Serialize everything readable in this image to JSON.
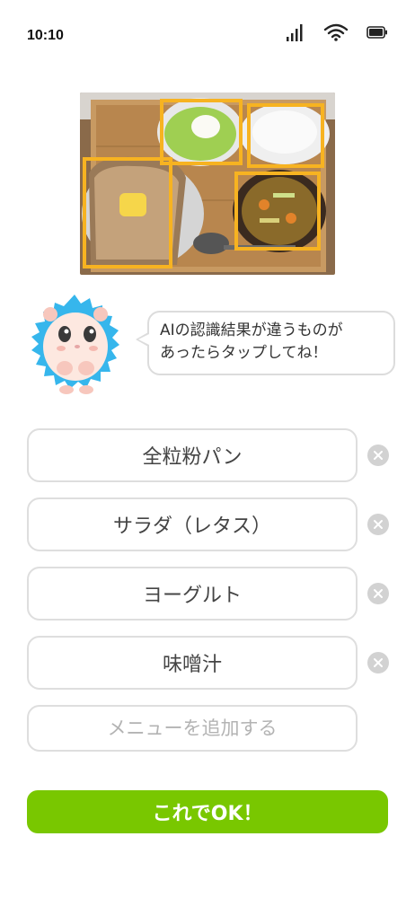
{
  "status_bar": {
    "time": "10:10",
    "icons": [
      "cellular-signal-icon",
      "wifi-icon",
      "battery-icon"
    ]
  },
  "photo": {
    "description_icon": "food-photo",
    "detected_box_color": "#f7b321",
    "detected_items_count": 4
  },
  "mascot": {
    "icon": "hedgehog-mascot",
    "bubble_line1": "AIの認識結果が違うものが",
    "bubble_line2": "あったらタップしてね！"
  },
  "food_items": [
    {
      "label": "全粒粉パン"
    },
    {
      "label": "サラダ（レタス）"
    },
    {
      "label": "ヨーグルト"
    },
    {
      "label": "味噌汁"
    }
  ],
  "add_menu": {
    "placeholder": "メニューを追加する"
  },
  "ok_button": {
    "label": "これでOK！"
  },
  "colors": {
    "accent_green": "#79c700",
    "box_orange": "#f7b321",
    "remove_gray": "#d2d2d2",
    "border_gray": "#dedede"
  }
}
